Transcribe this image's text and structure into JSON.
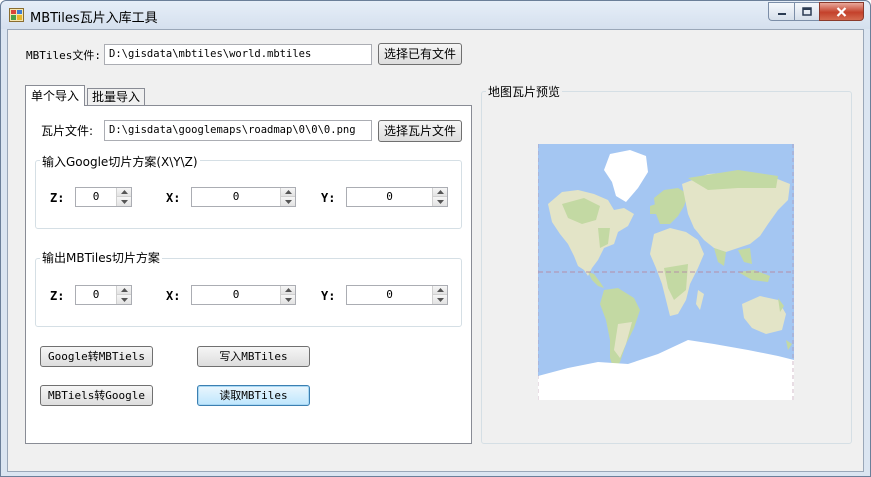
{
  "window": {
    "title": "MBTiles瓦片入库工具"
  },
  "mbtiles_file": {
    "label": "MBTiles文件:",
    "value": "D:\\gisdata\\mbtiles\\world.mbtiles",
    "button": "选择已有文件"
  },
  "tabs": [
    {
      "label": "单个导入",
      "active": true
    },
    {
      "label": "批量导入",
      "active": false
    }
  ],
  "tile_file": {
    "label": "瓦片文件:",
    "value": "D:\\gisdata\\googlemaps\\roadmap\\0\\0\\0.png",
    "button": "选择瓦片文件"
  },
  "google_group": {
    "title": "输入Google切片方案(X\\Y\\Z)",
    "z_label": "Z:",
    "z_value": "0",
    "x_label": "X:",
    "x_value": "0",
    "y_label": "Y:",
    "y_value": "0"
  },
  "mbtiles_group": {
    "title": "输出MBTiles切片方案",
    "z_label": "Z:",
    "z_value": "0",
    "x_label": "X:",
    "x_value": "0",
    "y_label": "Y:",
    "y_value": "0"
  },
  "buttons": {
    "google_to_mbtiles": "Google转MBTiels",
    "write_mbtiles": "写入MBTiles",
    "mbtiles_to_google": "MBTiels转Google",
    "read_mbtiles": "读取MBTiles"
  },
  "preview": {
    "title": "地图瓦片预览"
  },
  "colors": {
    "ocean": "#a4c6f2",
    "land": "#e3e4c7",
    "forest": "#c3d9a3",
    "ice": "#ffffff",
    "tropic_line": "#b48fa8"
  }
}
